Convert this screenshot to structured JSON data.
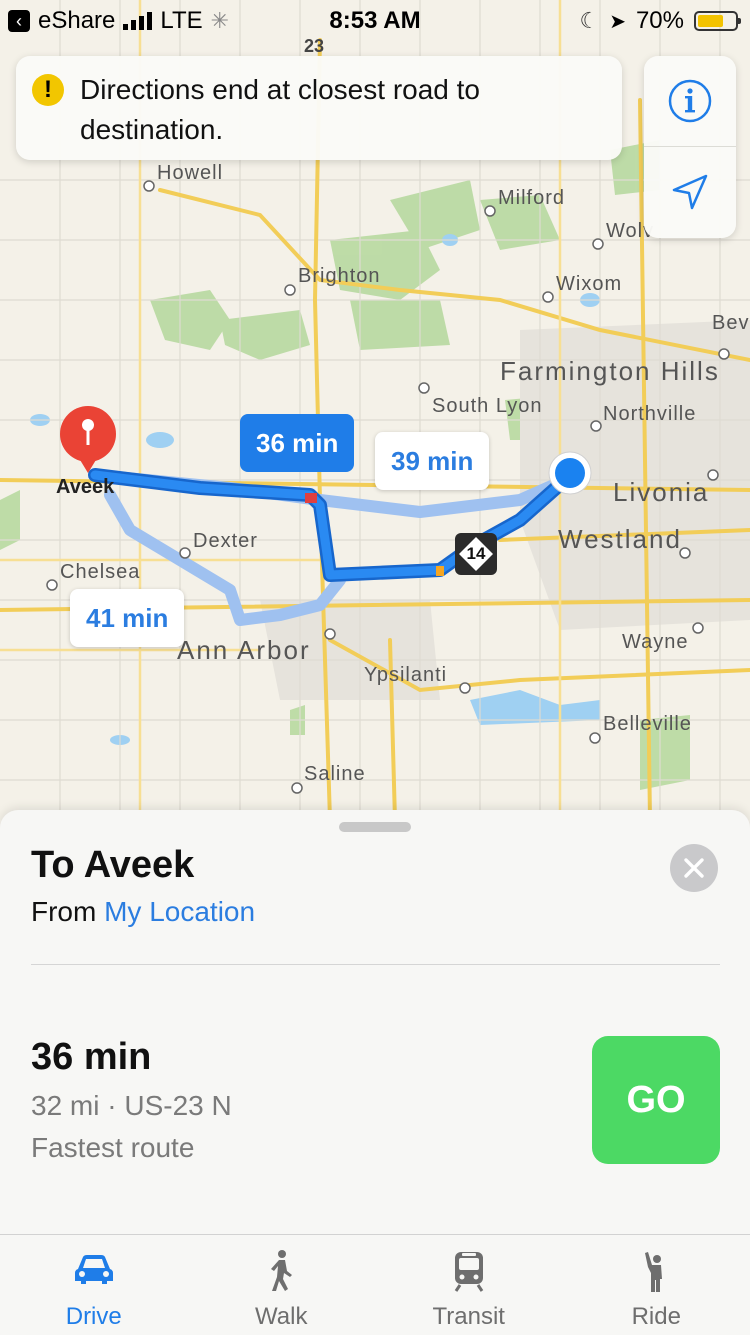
{
  "status_bar": {
    "carrier": "eShare",
    "network": "LTE",
    "time": "8:53 AM",
    "battery": "70%",
    "battery_level": 0.7
  },
  "banner": {
    "icon": "warning-icon",
    "text": "Directions end at closest road to destination."
  },
  "map": {
    "road_shield": "23",
    "places": [
      "Howell",
      "Milford",
      "Wolv",
      "Brighton",
      "Wixom",
      "Bev",
      "Farmington Hills",
      "South Lyon",
      "Northville",
      "Livonia",
      "Dexter",
      "Westland",
      "Chelsea",
      "Ann Arbor",
      "Wayne",
      "Ypsilanti",
      "Belleville",
      "Saline"
    ],
    "destination_label": "Aveek",
    "route_shield": "14",
    "route_times": {
      "primary": "36 min",
      "alt_north": "39 min",
      "alt_south": "41 min"
    },
    "colors": {
      "primary_route": "#1f7de8",
      "alternate_route": "#9fc1f0",
      "pin": "#ea4335"
    }
  },
  "sheet": {
    "title": "To Aveek",
    "from_label": "From",
    "from_location": "My Location",
    "route": {
      "time": "36 min",
      "distance": "32 mi · US-23 N",
      "note": "Fastest route"
    },
    "go_label": "GO",
    "go_color": "#4cd964"
  },
  "tabs": [
    {
      "label": "Drive",
      "icon": "car-icon",
      "active": true
    },
    {
      "label": "Walk",
      "icon": "walk-icon",
      "active": false
    },
    {
      "label": "Transit",
      "icon": "train-icon",
      "active": false
    },
    {
      "label": "Ride",
      "icon": "ride-icon",
      "active": false
    }
  ]
}
